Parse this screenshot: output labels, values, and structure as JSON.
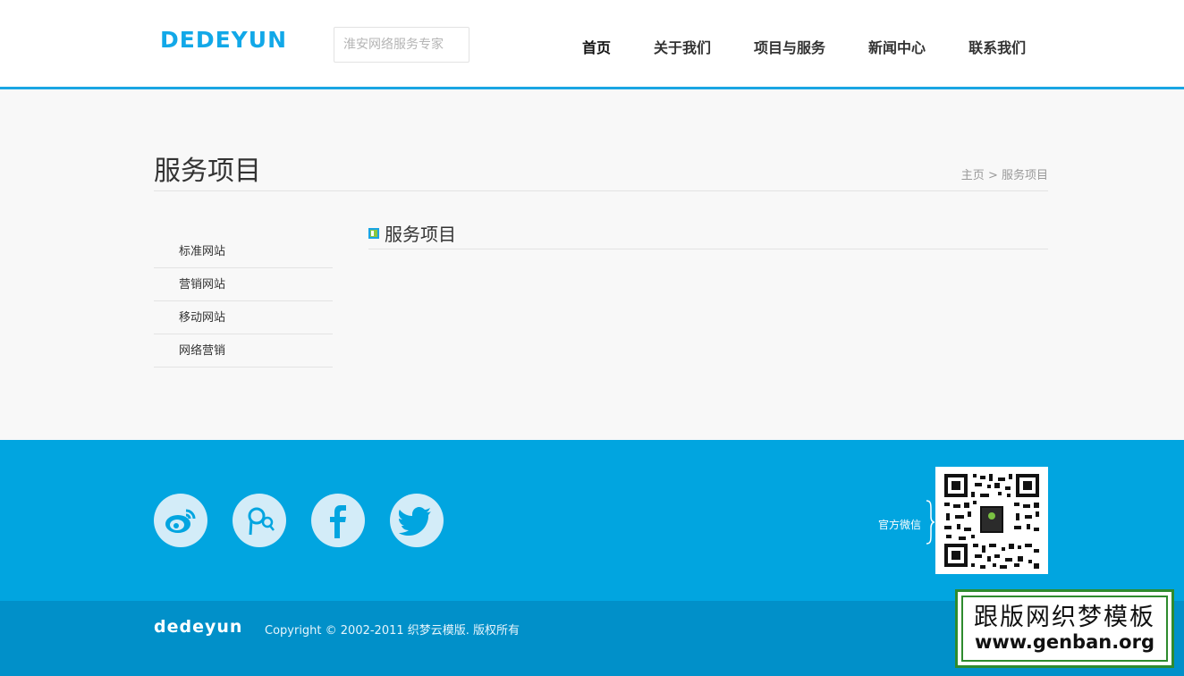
{
  "header": {
    "logo": "DEDEYUN",
    "search_placeholder": "淮安网络服务专家",
    "nav": [
      "首页",
      "关于我们",
      "项目与服务",
      "新闻中心",
      "联系我们"
    ]
  },
  "page": {
    "title": "服务项目",
    "breadcrumb": {
      "home": "主页",
      "separator": ">",
      "current": "服务项目"
    }
  },
  "sidebar": {
    "items": [
      "标准网站",
      "营销网站",
      "移动网站",
      "网络营销"
    ]
  },
  "main": {
    "section_title": "服务项目"
  },
  "footer": {
    "social": [
      "weibo-icon",
      "tencent-weibo-icon",
      "facebook-icon",
      "twitter-icon"
    ],
    "wechat_label": "官方微信",
    "logo": "dedeyun",
    "copyright": "Copyright © 2002-2011 织梦云模版. 版权所有"
  },
  "watermark": {
    "line1": "跟版网织梦模板",
    "line2": "www.genban.org"
  },
  "colors": {
    "accent": "#1aa5e3",
    "footer_bg": "#01a5e0",
    "bottom_bar": "#0190c9",
    "social_bg": "#d3ecf8"
  }
}
